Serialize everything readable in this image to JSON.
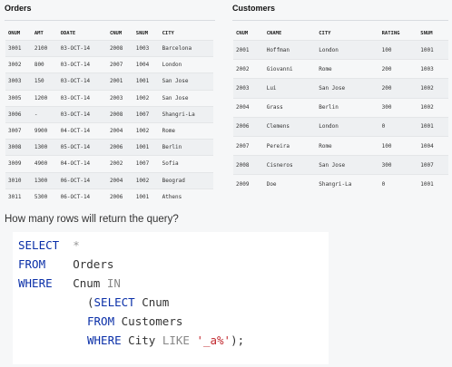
{
  "orders": {
    "title": "Orders",
    "headers": [
      "ONUM",
      "AMT",
      "ODATE",
      "CNUM",
      "SNUM",
      "CITY"
    ],
    "rows": [
      [
        "3001",
        "2100",
        "03-OCT-14",
        "2008",
        "1003",
        "Barcelona"
      ],
      [
        "3002",
        "800",
        "03-OCT-14",
        "2007",
        "1004",
        "London"
      ],
      [
        "3003",
        "150",
        "03-OCT-14",
        "2001",
        "1001",
        "San Jose"
      ],
      [
        "3005",
        "1200",
        "03-OCT-14",
        "2003",
        "1002",
        "San Jose"
      ],
      [
        "3006",
        "-",
        "03-OCT-14",
        "2008",
        "1007",
        "Shangri-La"
      ],
      [
        "3007",
        "9900",
        "04-OCT-14",
        "2004",
        "1002",
        "Rome"
      ],
      [
        "3008",
        "1300",
        "05-OCT-14",
        "2006",
        "1001",
        "Berlin"
      ],
      [
        "3009",
        "4900",
        "04-OCT-14",
        "2002",
        "1007",
        "Sofia"
      ],
      [
        "3010",
        "1300",
        "06-OCT-14",
        "2004",
        "1002",
        "Beograd"
      ],
      [
        "3011",
        "5300",
        "06-OCT-14",
        "2006",
        "1001",
        "Athens"
      ]
    ]
  },
  "customers": {
    "title": "Customers",
    "headers": [
      "CNUM",
      "CNAME",
      "CITY",
      "RATING",
      "SNUM"
    ],
    "rows": [
      [
        "2001",
        "Hoffman",
        "London",
        "100",
        "1001"
      ],
      [
        "2002",
        "Giovanni",
        "Rome",
        "200",
        "1003"
      ],
      [
        "2003",
        "Lui",
        "San Jose",
        "200",
        "1002"
      ],
      [
        "2004",
        "Grass",
        "Berlin",
        "300",
        "1002"
      ],
      [
        "2006",
        "Clemens",
        "London",
        "0",
        "1001"
      ],
      [
        "2007",
        "Pereira",
        "Rome",
        "100",
        "1004"
      ],
      [
        "2008",
        "Cisneros",
        "San Jose",
        "300",
        "1007"
      ],
      [
        "2009",
        "Doe",
        "Shangri-La",
        "0",
        "1001"
      ]
    ]
  },
  "question": "How many rows will return the query?",
  "code": {
    "select": "SELECT",
    "star": "*",
    "from": "FROM",
    "orders": "Orders",
    "where": "WHERE",
    "cnum": "Cnum",
    "in": "IN",
    "open_paren": "(",
    "sub_select": "SELECT",
    "sub_cnum": "Cnum",
    "sub_from": "FROM",
    "customers": "Customers",
    "sub_where": "WHERE",
    "city": "City",
    "like": "LIKE",
    "pattern": "'_a%'",
    "close": ");"
  }
}
